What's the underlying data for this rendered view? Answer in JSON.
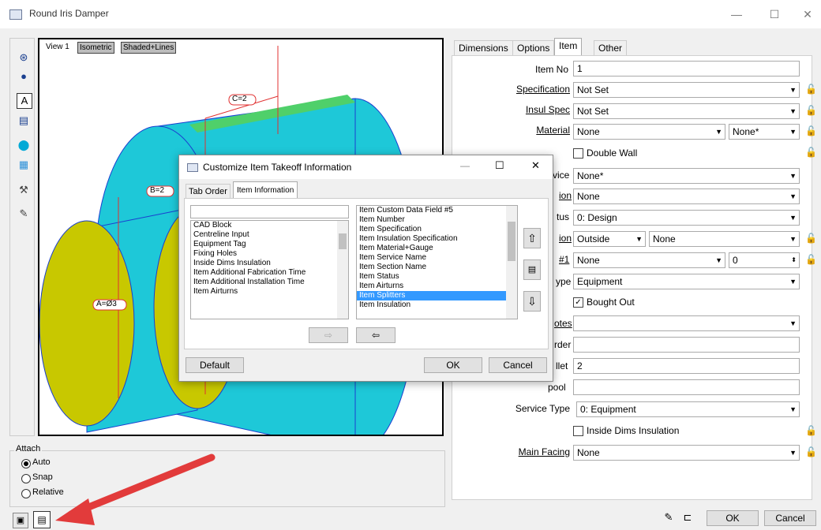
{
  "window": {
    "title": "Round Iris Damper"
  },
  "viewport": {
    "view_label": "View 1",
    "isometric_button": "Isometric",
    "shading_button": "Shaded+Lines",
    "dimensions": {
      "c": "C=2",
      "b": "B=2",
      "a": "A=Ø3"
    }
  },
  "attach": {
    "group_label": "Attach",
    "options": [
      "Auto",
      "Snap",
      "Relative"
    ],
    "selected": "Auto"
  },
  "tabs": [
    "Dimensions",
    "Options",
    "Item",
    "Other"
  ],
  "active_tab": "Item",
  "item_panel": {
    "item_no_label": "Item No",
    "item_no_value": "1",
    "specification_label": "Specification",
    "specification_value": "Not Set",
    "insul_spec_label": "Insul Spec",
    "insul_spec_value": "Not Set",
    "material_label": "Material",
    "material_value": "None",
    "material_gauge_value": "None*",
    "double_wall_label": "Double Wall",
    "service_label_partial": "vice",
    "service_value": "None*",
    "section_label_partial": "ion",
    "section_value": "None",
    "status_label_partial": "tus",
    "status_value": "0: Design",
    "insulation_label_partial": "ion",
    "insulation_pos_value": "Outside",
    "insulation_value": "None",
    "cid_label_partial": "#1",
    "cid_value": "None",
    "cid_number": "0",
    "type_label_partial": "ype",
    "type_value": "Equipment",
    "bought_out_label": "Bought Out",
    "notes_label_partial": "otes",
    "notes_value": "",
    "order_label_partial": "rder",
    "order_value": "",
    "pallet_label_partial": "llet",
    "pallet_value": "2",
    "spool_label_partial": "pool",
    "spool_value": "",
    "service_type_label": "Service Type",
    "service_type_value": "0: Equipment",
    "inside_dims_label": "Inside Dims Insulation",
    "main_facing_label": "Main Facing",
    "main_facing_value": "None"
  },
  "bottom": {
    "ok": "OK",
    "cancel": "Cancel"
  },
  "dialog": {
    "title": "Customize Item Takeoff Information",
    "tabs": [
      "Tab Order",
      "Item Information"
    ],
    "active_tab": "Item Information",
    "left_list": [
      "CAD Block",
      "Centreline Input",
      "Equipment Tag",
      "Fixing Holes",
      "Inside Dims Insulation",
      "Item Additional Fabrication Time",
      "Item Additional Installation Time",
      "Item Airturns"
    ],
    "right_list": [
      "Item Custom Data Field #5",
      "Item Number",
      "Item Specification",
      "Item Insulation Specification",
      "Item Material+Gauge",
      "Item Service Name",
      "Item Section Name",
      "Item Status",
      "Item Airturns",
      "Item Splitters",
      "Item Insulation"
    ],
    "right_selected": "Item Splitters",
    "default_button": "Default",
    "ok_button": "OK",
    "cancel_button": "Cancel"
  },
  "colors": {
    "cyan": "#1ec8d8",
    "yellow": "#c8c800",
    "selection": "#3399ff",
    "arrow": "#e23b3b"
  }
}
